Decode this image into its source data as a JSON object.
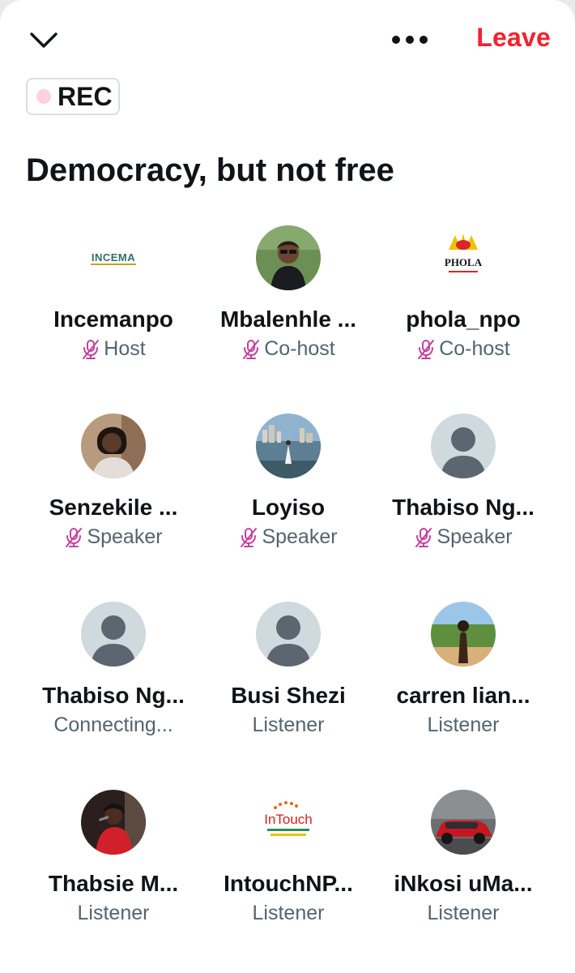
{
  "header": {
    "leave_label": "Leave",
    "rec_label": "REC"
  },
  "space": {
    "title": "Democracy, but not free"
  },
  "colors": {
    "leave": "#f4212e",
    "muted_mic": "#c63fa1",
    "role_text": "#536471",
    "name_text": "#0f1419",
    "rec_dot": "#ffd1e0"
  },
  "participants": [
    {
      "name": "Incemanpo",
      "role": "Host",
      "muted": true,
      "avatar": "logo-incema"
    },
    {
      "name": "Mbalenhle ...",
      "role": "Co-host",
      "muted": true,
      "avatar": "photo-woman-glasses"
    },
    {
      "name": "phola_npo",
      "role": "Co-host",
      "muted": true,
      "avatar": "logo-phola"
    },
    {
      "name": "Senzekile ...",
      "role": "Speaker",
      "muted": true,
      "avatar": "photo-woman-portrait"
    },
    {
      "name": "Loyiso",
      "role": "Speaker",
      "muted": true,
      "avatar": "photo-beach-city"
    },
    {
      "name": "Thabiso Ng...",
      "role": "Speaker",
      "muted": true,
      "avatar": "default-user"
    },
    {
      "name": "Thabiso Ng...",
      "role": "Connecting...",
      "muted": false,
      "avatar": "default-user"
    },
    {
      "name": "Busi Shezi",
      "role": "Listener",
      "muted": false,
      "avatar": "default-user"
    },
    {
      "name": "carren lian...",
      "role": "Listener",
      "muted": false,
      "avatar": "photo-outdoor-person"
    },
    {
      "name": "Thabsie M...",
      "role": "Listener",
      "muted": false,
      "avatar": "photo-singer-red"
    },
    {
      "name": "IntouchNP...",
      "role": "Listener",
      "muted": false,
      "avatar": "logo-intouch"
    },
    {
      "name": "iNkosi uMa...",
      "role": "Listener",
      "muted": false,
      "avatar": "photo-red-car"
    }
  ],
  "avatar_logo_text": {
    "incema": "INCEMA",
    "phola": "PHOLA",
    "intouch": "InTouch"
  }
}
